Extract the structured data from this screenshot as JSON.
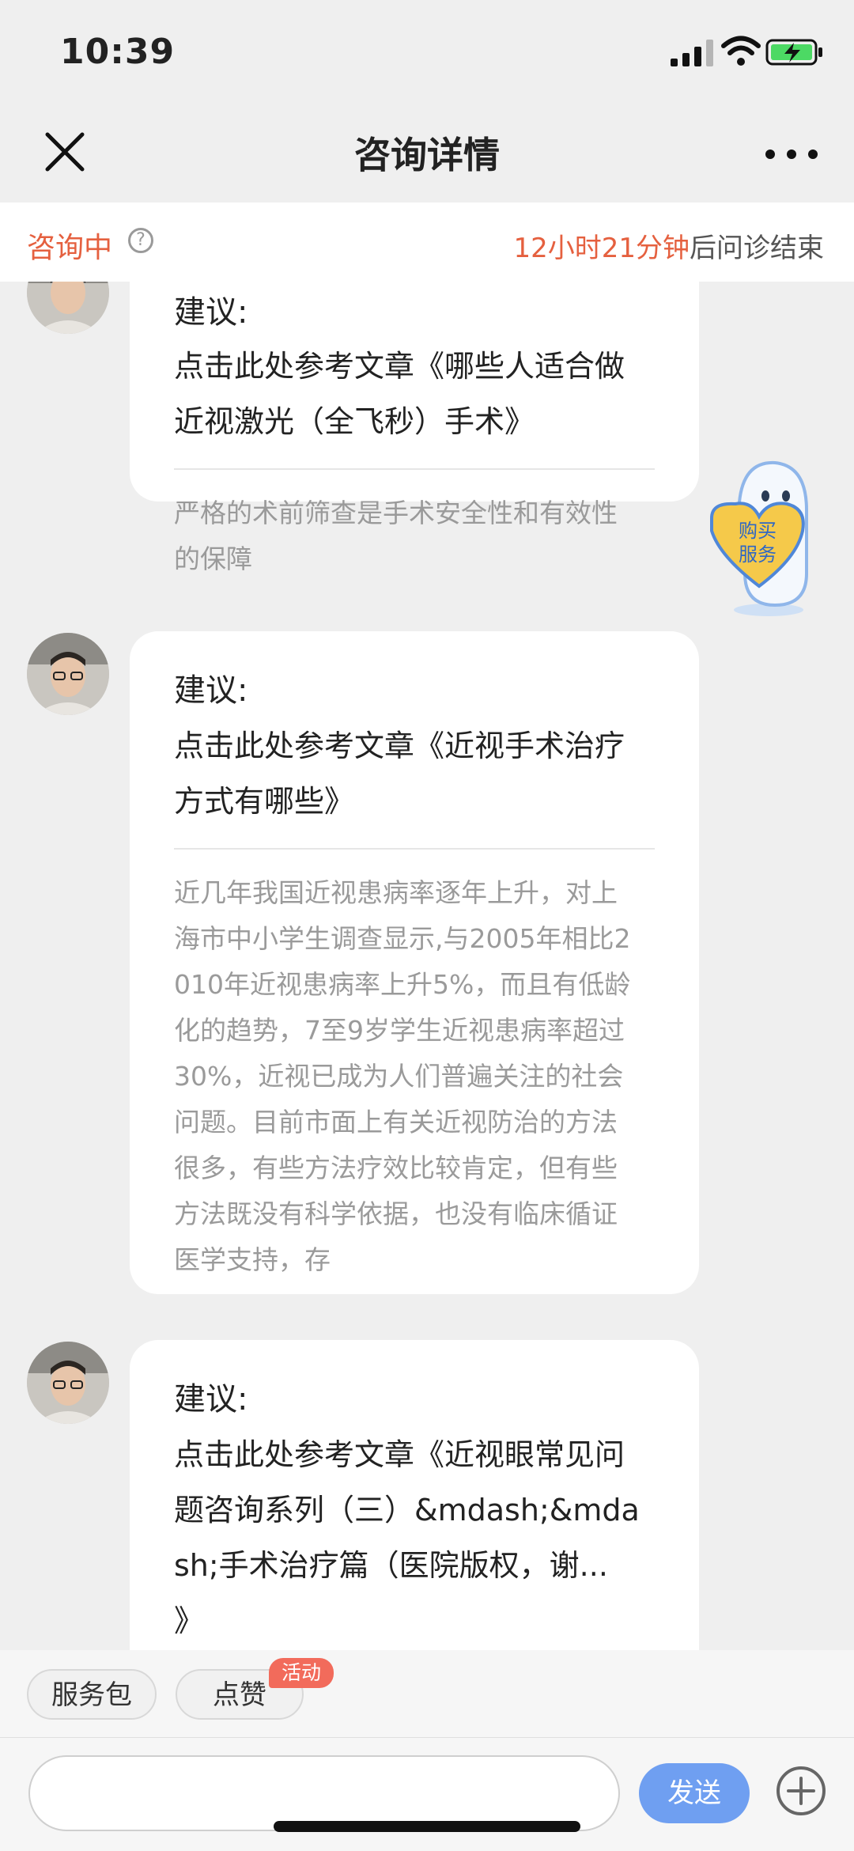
{
  "status_bar": {
    "time": "10:39",
    "icons": [
      "signal-icon",
      "wifi-icon",
      "battery-charging-icon"
    ]
  },
  "nav": {
    "title": "咨询详情",
    "left_icon": "close-icon",
    "right_icon": "more-icon"
  },
  "banner": {
    "state": "咨询中",
    "help_icon": "?",
    "countdown_time": "12小时21分钟",
    "countdown_suffix": "后问诊结束"
  },
  "messages": [
    {
      "heading": "建议:",
      "link_lines": [
        "点击此处参考文章《哪些人适合做",
        "近视激光（全飞秒）手术》"
      ],
      "desc_lines": [
        "严格的术前筛查是手术安全性和有效性",
        "的保障"
      ]
    },
    {
      "heading": "建议:",
      "link_lines": [
        "点击此处参考文章《近视手术治疗",
        "方式有哪些》"
      ],
      "desc_lines": [
        "近几年我国近视患病率逐年上升，对上",
        "海市中小学生调查显示,与2005年相比2",
        "010年近视患病率上升5%，而且有低龄",
        "化的趋势，7至9岁学生近视患病率超过",
        "30%，近视已成为人们普遍关注的社会",
        "问题。目前市面上有关近视防治的方法",
        "很多，有些方法疗效比较肯定，但有些",
        "方法既没有科学依据，也没有临床循证",
        "医学支持，存"
      ]
    },
    {
      "heading": "建议:",
      "link_lines": [
        "点击此处参考文章《近视眼常见问",
        "题咨询系列（三）&mdash;&mda",
        "sh;手术治疗篇（医院版权，谢...",
        "》"
      ]
    }
  ],
  "mascot": {
    "line1": "购买",
    "line2": "服务"
  },
  "tags": [
    {
      "label": "服务包"
    },
    {
      "label": "点赞"
    }
  ],
  "tag_badge": "活动",
  "input": {
    "placeholder": "",
    "send_label": "发送"
  },
  "colors": {
    "accent": "#e5603f",
    "send": "#6f9ff1",
    "background": "#efefef"
  }
}
